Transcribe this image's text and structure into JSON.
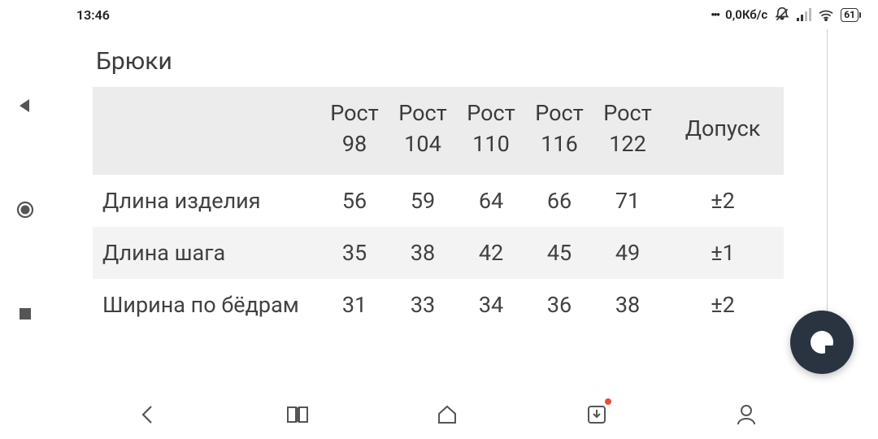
{
  "statusbar": {
    "time": "13:46",
    "speed": "0,0Кб/с",
    "battery": "61"
  },
  "page": {
    "title": "Брюки"
  },
  "table": {
    "headers": {
      "blank": "",
      "c0": "Рост 98",
      "c1": "Рост 104",
      "c2": "Рост 110",
      "c3": "Рост 116",
      "c4": "Рост 122",
      "tolerance": "Допуск"
    },
    "rows": [
      {
        "label": "Длина изделия",
        "v": [
          "56",
          "59",
          "64",
          "66",
          "71"
        ],
        "tol": "±2"
      },
      {
        "label": "Длина шага",
        "v": [
          "35",
          "38",
          "42",
          "45",
          "49"
        ],
        "tol": "±1"
      },
      {
        "label": "Ширина по бёдрам",
        "v": [
          "31",
          "33",
          "34",
          "36",
          "38"
        ],
        "tol": "±2"
      }
    ]
  }
}
